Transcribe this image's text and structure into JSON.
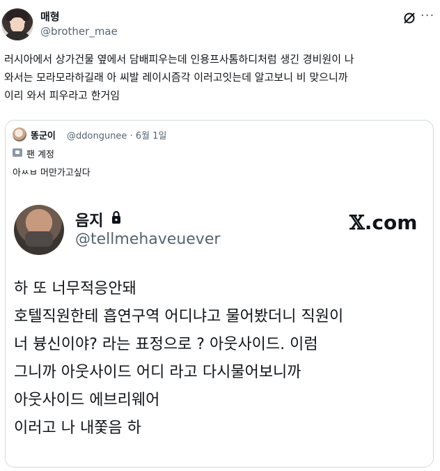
{
  "post": {
    "author_name": "매형",
    "author_handle": "@brother_mae",
    "text_lines": [
      "러시아에서 상가건물 옆에서 담배피우는데 인용프사톰하디처럼 생긴 경비원이 나",
      "와서는 모라모라하길래 아 씨발 레이시즘각 이러고잇는데 알고보니 비 맞으니까",
      "이리 와서 피우라고 한거임"
    ],
    "icons": {
      "grok": "grok-icon",
      "more": "more-icon"
    },
    "more_label": "···"
  },
  "quote": {
    "author_name": "똥군이",
    "author_handle": "@ddongunee · 6월 1일",
    "fan_label": "팬 계정",
    "text": "아ㅆㅂ 머만가고싶다",
    "card": {
      "name": "음지",
      "handle": "@tellmehaveuever",
      "brand_x": "𝕏",
      "brand_rest": ".com",
      "lines": [
        "하 또 너무적응안돼",
        "호텔직원한테 흡연구역 어디냐고 물어봤더니 직원이",
        "너 븅신이야? 라는 표정으로 ? 아웃사이드. 이럼",
        "그니까 아웃사이드 어디 라고 다시물어보니까",
        "아웃사이드 에브리웨어",
        "이러고 나 내쫓음 하"
      ]
    }
  },
  "colors": {
    "text": "#0f1419",
    "muted": "#536471",
    "border": "#cfd9de"
  }
}
